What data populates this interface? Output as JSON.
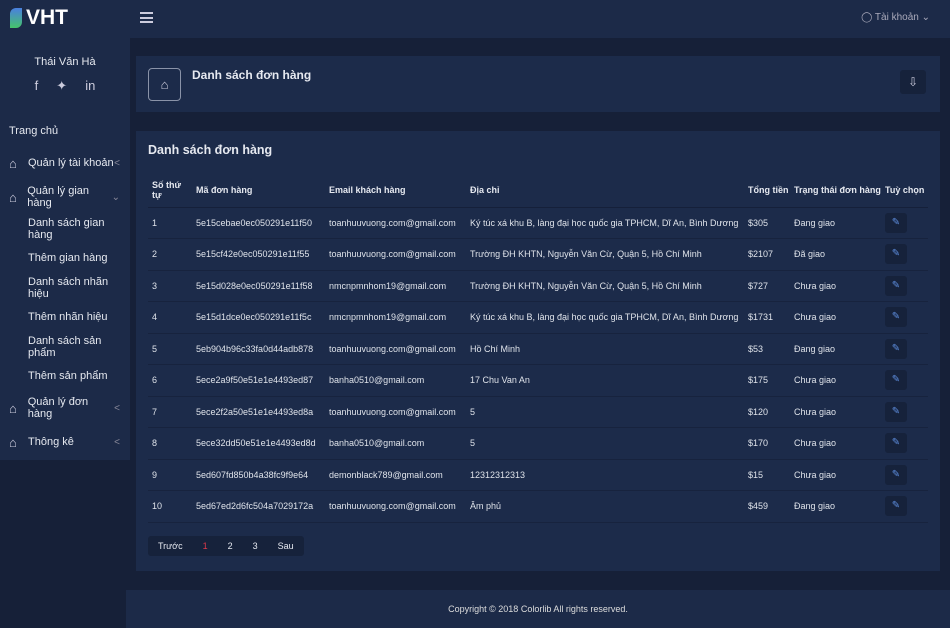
{
  "topbar": {
    "brand": "VHT",
    "account": "Tài khoản"
  },
  "sidebar": {
    "user_name": "Thái Văn Hà",
    "social": [
      "facebook-icon",
      "twitter-icon",
      "linkedin-icon"
    ],
    "home": "Trang chủ",
    "items": [
      {
        "label": "Quản lý tài khoản",
        "expanded": false
      },
      {
        "label": "Quản lý gian hàng",
        "expanded": true,
        "children": [
          "Danh sách gian hàng",
          "Thêm gian hàng",
          "Danh sách nhãn hiệu",
          "Thêm nhãn hiệu",
          "Danh sách sản phẩm",
          "Thêm sản phẩm"
        ]
      },
      {
        "label": "Quản lý đơn hàng",
        "expanded": false
      },
      {
        "label": "Thông kê",
        "expanded": false
      }
    ]
  },
  "header": {
    "title": "Danh sách đơn hàng"
  },
  "orders": {
    "title": "Danh sách đơn hàng",
    "columns": [
      "Số thứ tự",
      "Mã đơn hàng",
      "Email khách hàng",
      "Địa chỉ",
      "Tổng tiền",
      "Trạng thái đơn hàng",
      "Tuỳ chọn"
    ],
    "rows": [
      [
        "1",
        "5e15cebae0ec050291e11f50",
        "toanhuuvuong.com@gmail.com",
        "Ký túc xá khu B, làng đại học quốc gia TPHCM, Dĩ An, Bình Dương",
        "$305",
        "Đang giao"
      ],
      [
        "2",
        "5e15cf42e0ec050291e11f55",
        "toanhuuvuong.com@gmail.com",
        "Trường ĐH KHTN, Nguyễn Văn Cừ, Quận 5, Hồ Chí Minh",
        "$2107",
        "Đã giao"
      ],
      [
        "3",
        "5e15d028e0ec050291e11f58",
        "nmcnpmnhom19@gmail.com",
        "Trường ĐH KHTN, Nguyễn Văn Cừ, Quận 5, Hồ Chí Minh",
        "$727",
        "Chưa giao"
      ],
      [
        "4",
        "5e15d1dce0ec050291e11f5c",
        "nmcnpmnhom19@gmail.com",
        "Ký túc xá khu B, làng đại học quốc gia TPHCM, Dĩ An, Bình Dương",
        "$1731",
        "Chưa giao"
      ],
      [
        "5",
        "5eb904b96c33fa0d44adb878",
        "toanhuuvuong.com@gmail.com",
        "Hồ Chí Minh",
        "$53",
        "Đang giao"
      ],
      [
        "6",
        "5ece2a9f50e51e1e4493ed87",
        "banha0510@gmail.com",
        "17 Chu Van An",
        "$175",
        "Chưa giao"
      ],
      [
        "7",
        "5ece2f2a50e51e1e4493ed8a",
        "toanhuuvuong.com@gmail.com",
        "5",
        "$120",
        "Chưa giao"
      ],
      [
        "8",
        "5ece32dd50e51e1e4493ed8d",
        "banha0510@gmail.com",
        "5",
        "$170",
        "Chưa giao"
      ],
      [
        "9",
        "5ed607fd850b4a38fc9f9e64",
        "demonblack789@gmail.com",
        "12312312313",
        "$15",
        "Chưa giao"
      ],
      [
        "10",
        "5ed67ed2d6fc504a7029172a",
        "toanhuuvuong.com@gmail.com",
        "Âm phủ",
        "$459",
        "Đang giao"
      ]
    ],
    "pagination": {
      "prev": "Trước",
      "pages": [
        "1",
        "2",
        "3"
      ],
      "current": "1",
      "next": "Sau"
    }
  },
  "footer": {
    "text": "Copyright © 2018 Colorlib All rights reserved."
  },
  "colors": {
    "panel": "#1c2a48",
    "background": "#162038",
    "card": "#1c2b4a",
    "active_page": "#e03a4a",
    "edit_icon": "#5f8fe0"
  }
}
